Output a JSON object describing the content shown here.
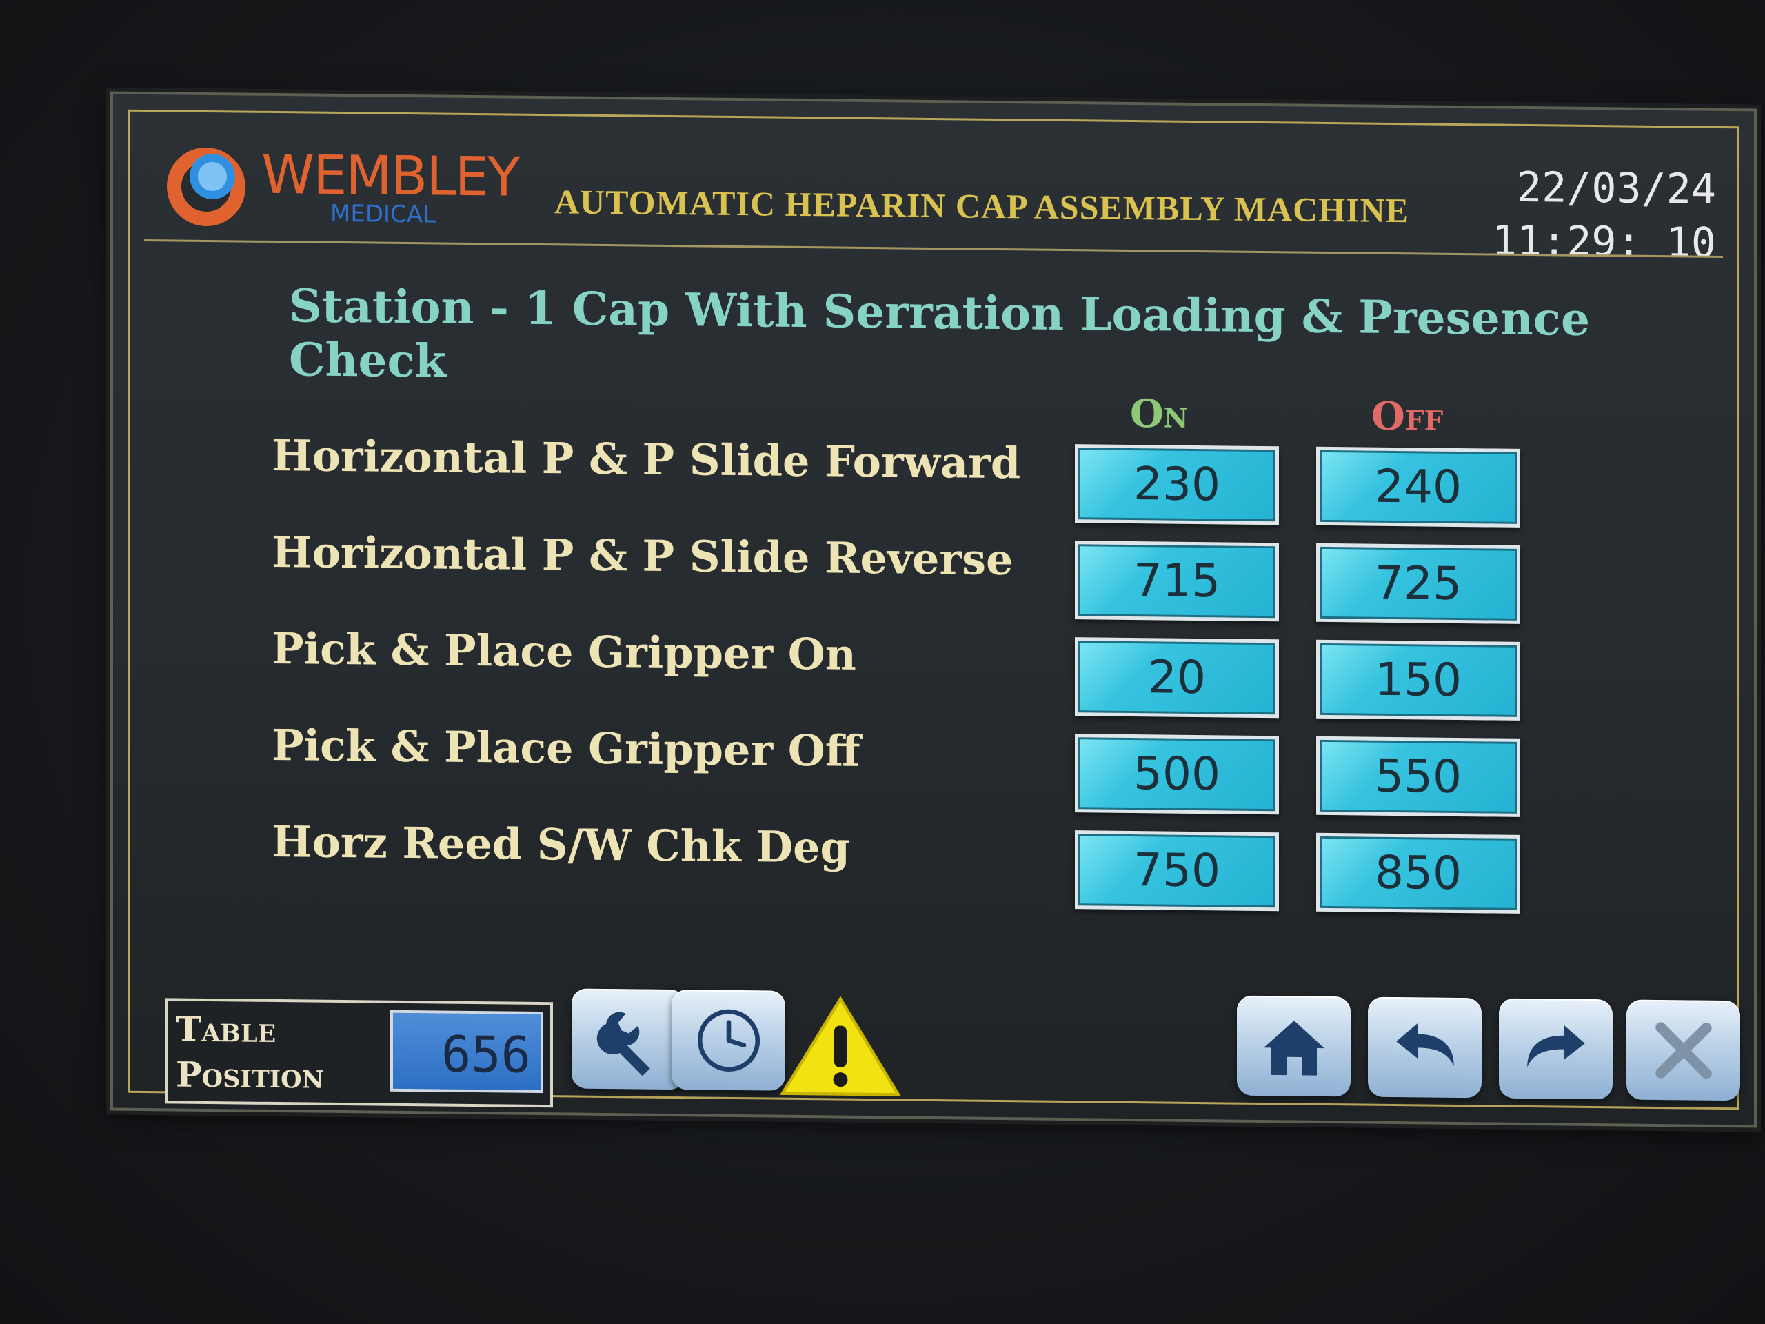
{
  "header": {
    "logo_text": "WEMBLEY",
    "logo_sub": "MEDICAL",
    "machine_title": "AUTOMATIC HEPARIN CAP ASSEMBLY MACHINE",
    "date": "22/03/24",
    "time": "11:29: 10"
  },
  "station": {
    "title": "Station - 1 Cap With Serration Loading & Presence Check",
    "col_on": "On",
    "col_off": "Off",
    "rows": [
      {
        "label": "Horizontal P & P Slide Forward",
        "on": "230",
        "off": "240"
      },
      {
        "label": "Horizontal P & P Slide Reverse",
        "on": "715",
        "off": "725"
      },
      {
        "label": "Pick & Place Gripper On",
        "on": "20",
        "off": "150"
      },
      {
        "label": "Pick & Place Gripper Off",
        "on": "500",
        "off": "550"
      },
      {
        "label": "Horz Reed S/W Chk Deg",
        "on": "750",
        "off": "850"
      }
    ]
  },
  "footer": {
    "table_label_1": "Table",
    "table_label_2": "Position",
    "table_value": "656",
    "icons": {
      "settings": "wrench-icon",
      "timer": "clock-icon",
      "alarm": "warning-icon",
      "home": "home-icon",
      "back": "back-arrow-icon",
      "forward": "forward-arrow-icon",
      "close": "close-icon"
    }
  },
  "colors": {
    "title_gold": "#d9c24f",
    "station_teal": "#86d3c4",
    "label_cream": "#ede3b4",
    "on_green": "#8ec776",
    "off_red": "#e26a66",
    "value_cyan": "#36c3df"
  }
}
